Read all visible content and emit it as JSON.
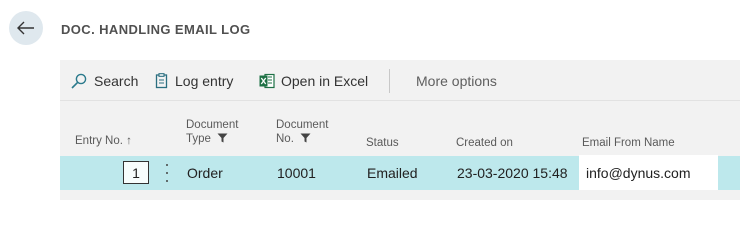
{
  "page": {
    "title": "DOC. HANDLING EMAIL LOG"
  },
  "toolbar": {
    "search_label": "Search",
    "log_entry_label": "Log entry",
    "open_excel_label": "Open in Excel",
    "more_options_label": "More options"
  },
  "table": {
    "columns": {
      "entry_no": "Entry No. ↑",
      "doc_type_line1": "Document",
      "doc_type_line2": "Type",
      "doc_no_line1": "Document",
      "doc_no_line2": "No.",
      "status": "Status",
      "created_on": "Created on",
      "email_from_name": "Email From Name"
    },
    "rows": [
      {
        "entry_no": "1",
        "document_type": "Order",
        "document_no": "10001",
        "status": "Emailed",
        "created_on": "23-03-2020 15:48",
        "email_from_name": "info@dynus.com"
      }
    ]
  },
  "colors": {
    "selected_row": "#bde8ec",
    "content_bg": "#f2f2f2",
    "back_button_bg": "#dfe8ee",
    "excel_green": "#1e7145",
    "search_teal": "#2b7a8c"
  },
  "icons": [
    "back-arrow-icon",
    "search-icon",
    "log-entry-icon",
    "excel-icon",
    "filter-icon",
    "more-vertical-icon"
  ]
}
